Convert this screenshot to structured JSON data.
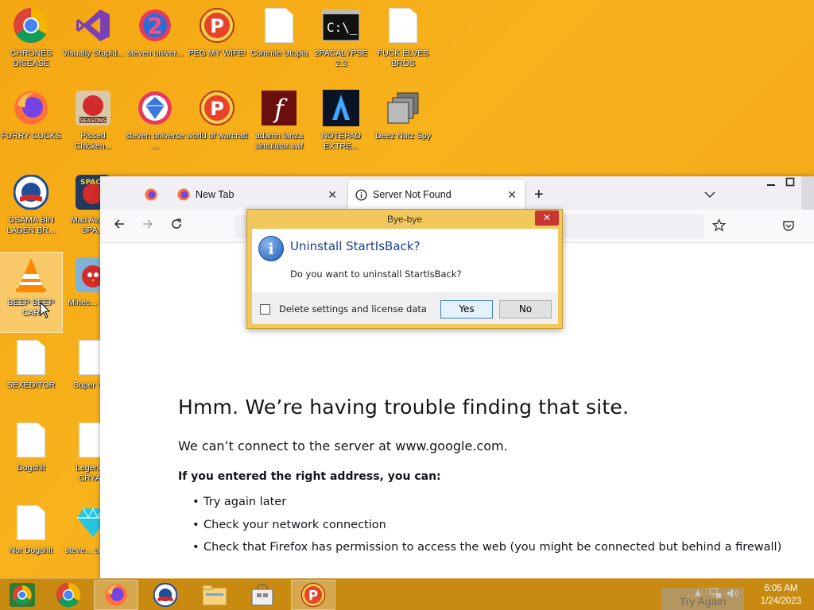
{
  "desktop": {
    "icons": [
      {
        "label": "CHRONES DISEASE",
        "icon": "chrome-icon"
      },
      {
        "label": "Visually Stupid...",
        "icon": "visual-studio-icon"
      },
      {
        "label": "steven univer...",
        "icon": "steven-universe-2-icon"
      },
      {
        "label": "PEG MY WIFE!",
        "icon": "peggle-icon"
      },
      {
        "label": "Commie Utopia",
        "icon": "file-icon"
      },
      {
        "label": "2PACALYPSE 2.3",
        "icon": "cmd-icon"
      },
      {
        "label": "FUCK ELVES BROS",
        "icon": "file-icon"
      },
      {
        "label": "FURRY CUCKS",
        "icon": "firefox-icon"
      },
      {
        "label": "Pissed Chicken...",
        "icon": "angry-birds-seasons-icon"
      },
      {
        "label": "steven universe ...",
        "icon": "gem-icon"
      },
      {
        "label": "world of warcraft",
        "icon": "peggle-icon"
      },
      {
        "label": "adamn lanza simulator.swf",
        "icon": "flash-icon"
      },
      {
        "label": "NOTEPAD EXTRE...",
        "icon": "notepad-extreme-icon"
      },
      {
        "label": "Deez Nutz Spy",
        "icon": "windows-stack-icon"
      },
      {
        "label": "OSAMA BIN LADEN BR...",
        "icon": "obama-logo-icon"
      },
      {
        "label": "Mad Av... IN SPA...",
        "icon": "angry-birds-space-icon"
      },
      {
        "label": "BEEP BEEP CAR",
        "icon": "vlc-icon"
      },
      {
        "label": "Minec... Birds",
        "icon": "angry-birds-icon"
      },
      {
        "label": "SEXEDITOR",
        "icon": "file-icon"
      },
      {
        "label": "Super Cr...",
        "icon": "file-icon"
      },
      {
        "label": "Dogshit",
        "icon": "file-icon"
      },
      {
        "label": "Legend... CRYA...",
        "icon": "file-icon"
      },
      {
        "label": "Not Dogshit",
        "icon": "file-icon"
      },
      {
        "label": "steve... unive...",
        "icon": "diamond-icon"
      }
    ]
  },
  "browser": {
    "tabs": [
      {
        "label": "",
        "icon": "firefox-icon"
      },
      {
        "label": "New Tab",
        "icon": "firefox-icon"
      },
      {
        "label": "Server Not Found",
        "icon": "info-icon"
      }
    ],
    "new_tab_symbol": "+",
    "error": {
      "title": "Hmm. We’re having trouble finding that site.",
      "description": "We can’t connect to the server at www.google.com.",
      "subtitle": "If you entered the right address, you can:",
      "suggestions": [
        "Try again later",
        "Check your network connection",
        "Check that Firefox has permission to access the web (you might be connected but behind a firewall)"
      ]
    }
  },
  "dialog": {
    "title": "Bye-bye",
    "heading": "Uninstall StartIsBack?",
    "message": "Do you want to uninstall StartIsBack?",
    "checkbox_label": "Delete settings and license data",
    "checkbox_checked": false,
    "yes_label": "Yes",
    "no_label": "No",
    "close_symbol": "✕",
    "info_symbol": "i"
  },
  "taskbar": {
    "items": [
      {
        "icon": "start-chrome-icon"
      },
      {
        "icon": "chrome-icon"
      },
      {
        "icon": "firefox-icon",
        "active": true
      },
      {
        "icon": "obama-logo-icon"
      },
      {
        "icon": "file-explorer-icon"
      },
      {
        "icon": "store-icon"
      },
      {
        "icon": "peggle-icon",
        "active": true
      }
    ],
    "clock_time": "6:05 AM",
    "clock_date": "1/24/2023",
    "try_again_label": "Try Again"
  },
  "colors": {
    "desktop": "#f4a713",
    "taskbar": "#c98a12",
    "dialog_frame": "#f2c75c",
    "dialog_heading": "#1b3d8f"
  }
}
